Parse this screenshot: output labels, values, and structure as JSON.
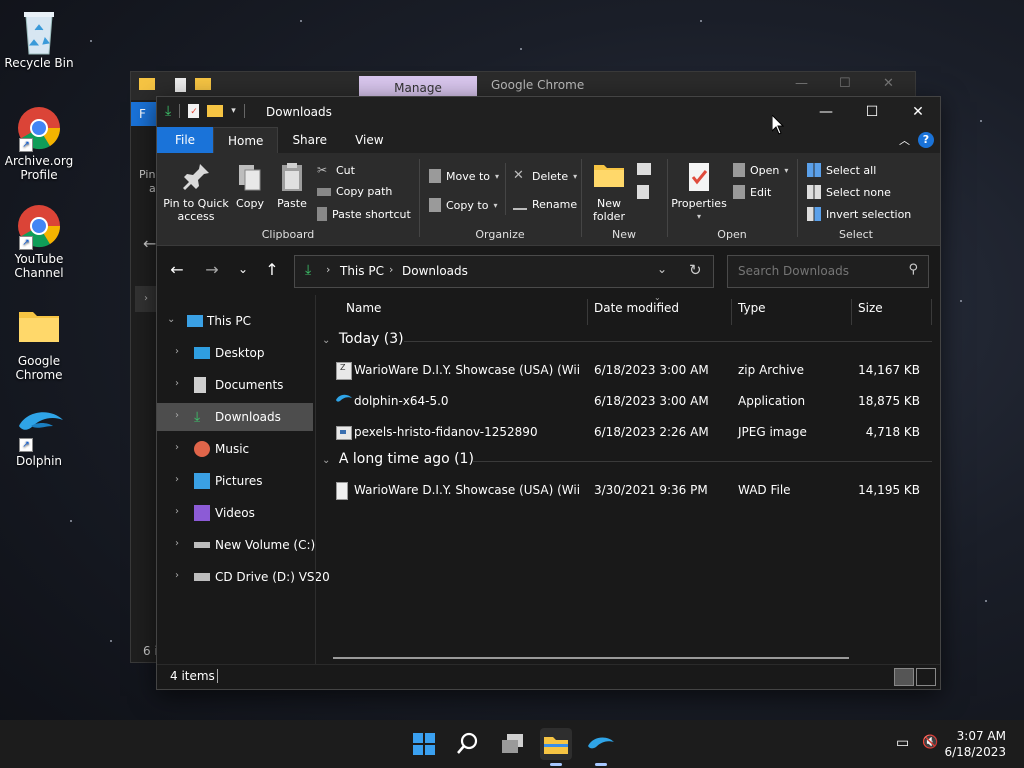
{
  "desktop": {
    "icons": [
      {
        "label": "Recycle Bin"
      },
      {
        "label": "Archive.org Profile"
      },
      {
        "label": "YouTube Channel"
      },
      {
        "label": "Google Chrome"
      },
      {
        "label": "Dolphin"
      }
    ]
  },
  "background_window": {
    "manage_tab": "Manage",
    "title": "Google Chrome",
    "partial_texts": [
      "F",
      "Pin",
      "a",
      "6 i"
    ]
  },
  "window": {
    "title": "Downloads",
    "tabs": [
      "File",
      "Home",
      "Share",
      "View"
    ],
    "ribbon": {
      "clipboard": {
        "label": "Clipboard",
        "pin": "Pin to Quick access",
        "copy": "Copy",
        "paste": "Paste",
        "cut": "Cut",
        "copy_path": "Copy path",
        "paste_shortcut": "Paste shortcut"
      },
      "organize": {
        "label": "Organize",
        "move_to": "Move to",
        "copy_to": "Copy to",
        "delete": "Delete",
        "rename": "Rename"
      },
      "new": {
        "label": "New",
        "new_folder": "New folder"
      },
      "open": {
        "label": "Open",
        "properties": "Properties",
        "open": "Open",
        "edit": "Edit"
      },
      "select": {
        "label": "Select",
        "select_all": "Select all",
        "select_none": "Select none",
        "invert": "Invert selection"
      }
    },
    "address": {
      "crumbs": [
        "This PC",
        "Downloads"
      ],
      "search_placeholder": "Search Downloads"
    },
    "nav": {
      "items": [
        {
          "label": "This PC"
        },
        {
          "label": "Desktop"
        },
        {
          "label": "Documents"
        },
        {
          "label": "Downloads"
        },
        {
          "label": "Music"
        },
        {
          "label": "Pictures"
        },
        {
          "label": "Videos"
        },
        {
          "label": "New Volume (C:)"
        },
        {
          "label": "CD Drive (D:) VS20"
        }
      ]
    },
    "columns": [
      "Name",
      "Date modified",
      "Type",
      "Size"
    ],
    "groups": [
      {
        "header": "Today (3)",
        "files": [
          {
            "name": "WarioWare D.I.Y. Showcase (USA) (WiiWare)",
            "date": "6/18/2023 3:00 AM",
            "type": "zip Archive",
            "size": "14,167 KB"
          },
          {
            "name": "dolphin-x64-5.0",
            "date": "6/18/2023 3:00 AM",
            "type": "Application",
            "size": "18,875 KB"
          },
          {
            "name": "pexels-hristo-fidanov-1252890",
            "date": "6/18/2023 2:26 AM",
            "type": "JPEG image",
            "size": "4,718 KB"
          }
        ]
      },
      {
        "header": "A long time ago (1)",
        "files": [
          {
            "name": "WarioWare D.I.Y. Showcase (USA) (WiiWare)",
            "date": "3/30/2021 9:36 PM",
            "type": "WAD File",
            "size": "14,195 KB"
          }
        ]
      }
    ],
    "status": {
      "count": "4 items"
    }
  },
  "taskbar": {
    "time": "3:07 AM",
    "date": "6/18/2023"
  },
  "colors": {
    "accent": "#1a73d9",
    "folder": "#f6c443",
    "download_green": "#3cc46a"
  }
}
